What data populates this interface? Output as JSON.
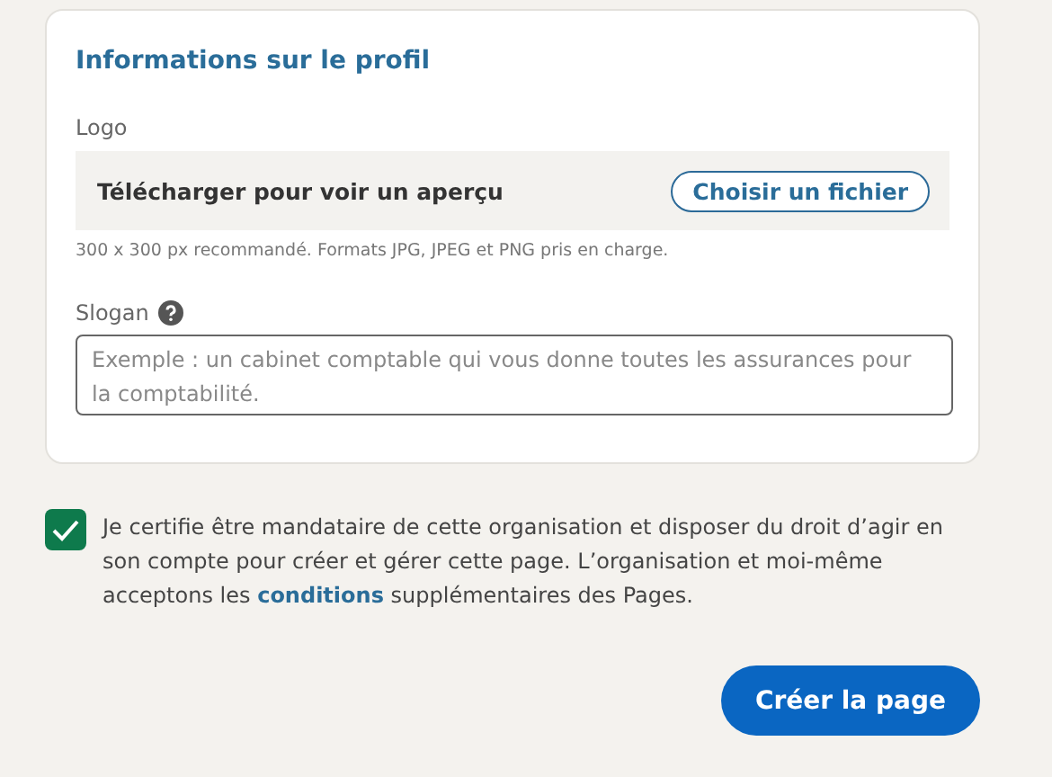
{
  "section": {
    "title": "Informations sur le profil",
    "logo": {
      "label": "Logo",
      "upload_text": "Télécharger pour voir un aperçu",
      "button": "Choisir un fichier",
      "hint": "300 x 300 px recommandé. Formats JPG, JPEG et PNG pris en charge."
    },
    "slogan": {
      "label": "Slogan",
      "placeholder": "Exemple : un cabinet comptable qui vous donne toutes les assurances pour la comptabilité."
    }
  },
  "consent": {
    "checked": true,
    "text_before": "Je certifie être mandataire de cette organisation et disposer du droit d’agir en son compte pour créer et gérer cette page. L’organisation et moi-même acceptons les",
    "link": "conditions",
    "text_after": "supplémentaires des Pages."
  },
  "submit": "Créer la page"
}
